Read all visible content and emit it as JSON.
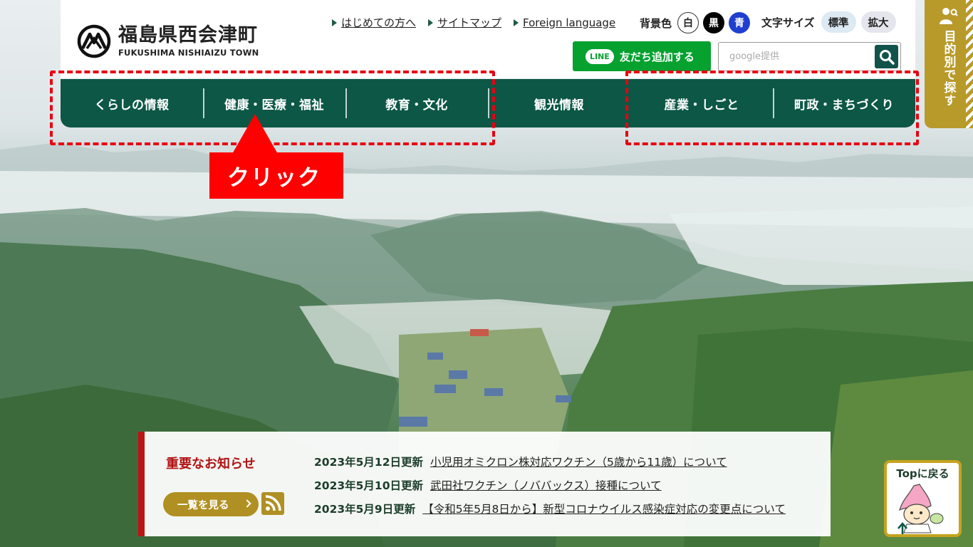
{
  "site": {
    "name_jp": "福島県西会津町",
    "name_en": "FUKUSHIMA NISHIAIZU TOWN"
  },
  "util_links": [
    "はじめての方へ",
    "サイトマップ",
    "Foreign language"
  ],
  "bg_color": {
    "label": "背景色",
    "options": [
      "白",
      "黒",
      "青"
    ],
    "colors": [
      "#ffffff",
      "#000000",
      "#1f3fd1"
    ]
  },
  "font_size": {
    "label": "文字サイズ",
    "options": [
      "標準",
      "拡大"
    ]
  },
  "line_button": {
    "badge": "LINE",
    "label": "友だち追加する"
  },
  "search": {
    "placeholder": "google提供"
  },
  "nav": [
    "くらしの情報",
    "健康・医療・福祉",
    "教育・文化",
    "観光情報",
    "産業・しごと",
    "町政・まちづくり"
  ],
  "annotation": {
    "callout": "クリック",
    "color": "#e60012"
  },
  "side_tab": {
    "label": "目的別で探す"
  },
  "news": {
    "title": "重要なお知らせ",
    "more_label": "一覧を見る",
    "items": [
      {
        "date": "2023年5月12日更新",
        "text": "小児用オミクロン株対応ワクチン（5歳から11歳）について"
      },
      {
        "date": "2023年5月10日更新",
        "text": "武田社ワクチン（ノババックス）接種について"
      },
      {
        "date": "2023年5月9日更新",
        "text": "【令和5年5月8日から】新型コロナウイルス感染症対応の変更点について"
      }
    ]
  },
  "to_top": {
    "label": "Topに戻る"
  },
  "theme": {
    "green": "#0c5746",
    "gold": "#b09022",
    "red": "#bd1515"
  }
}
